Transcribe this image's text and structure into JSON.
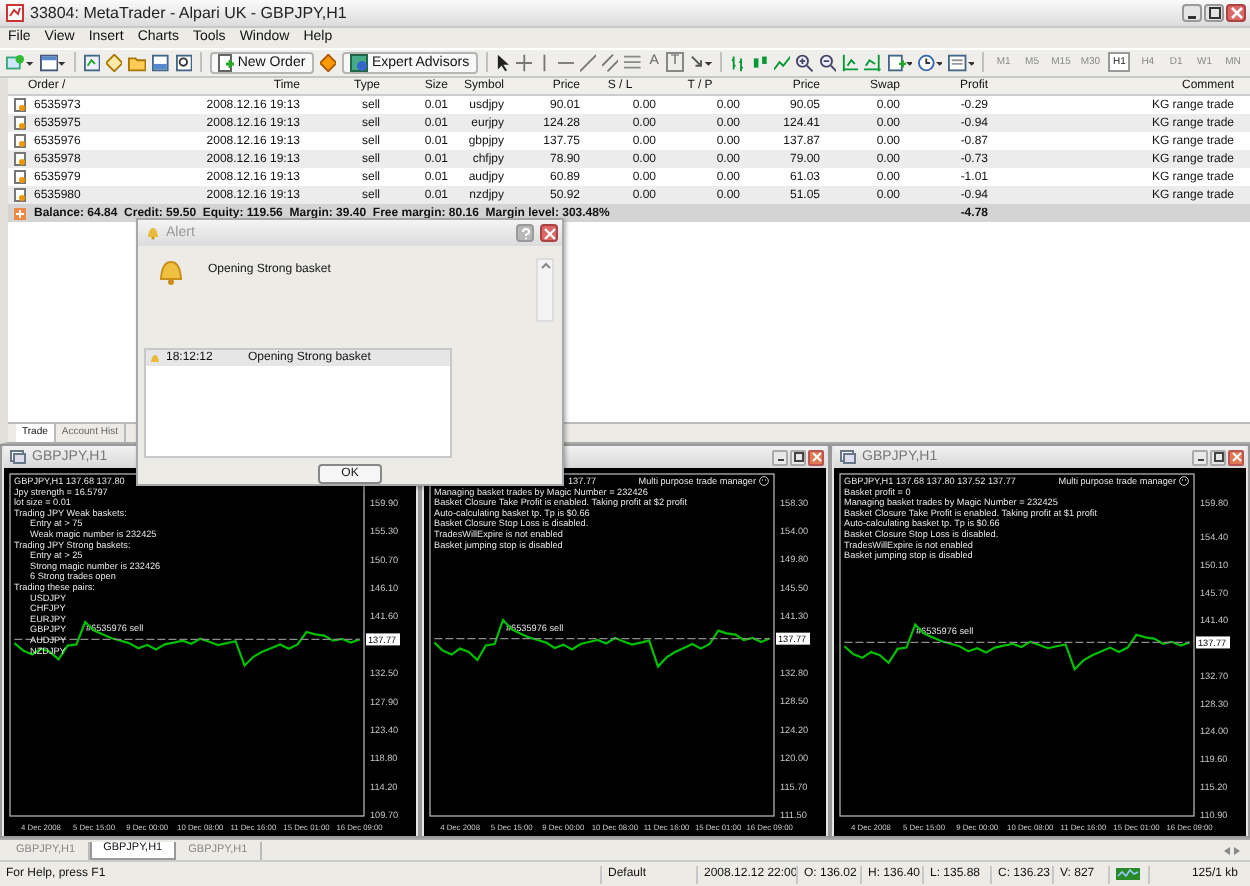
{
  "window": {
    "title": "33804: MetaTrader - Alpari UK - GBPJPY,H1"
  },
  "menu": [
    "File",
    "View",
    "Insert",
    "Charts",
    "Tools",
    "Window",
    "Help"
  ],
  "toolbar": {
    "new_order": "New Order",
    "expert_advisors": "Expert Advisors",
    "text_tools": [
      "A",
      "T"
    ],
    "timeframes": [
      {
        "label": "M1",
        "selected": false
      },
      {
        "label": "M5",
        "selected": false
      },
      {
        "label": "M15",
        "selected": false
      },
      {
        "label": "M30",
        "selected": false
      },
      {
        "label": "H1",
        "selected": true
      },
      {
        "label": "H4",
        "selected": false
      },
      {
        "label": "D1",
        "selected": false
      },
      {
        "label": "W1",
        "selected": false
      },
      {
        "label": "MN",
        "selected": false
      }
    ]
  },
  "terminal": {
    "columns": [
      "Order /",
      "Time",
      "Type",
      "Size",
      "Symbol",
      "Price",
      "S / L",
      "T / P",
      "Price",
      "Swap",
      "Profit",
      "Comment"
    ],
    "rows": [
      [
        "6535973",
        "2008.12.16 19:13",
        "sell",
        "0.01",
        "usdjpy",
        "90.01",
        "0.00",
        "0.00",
        "90.05",
        "0.00",
        "-0.29",
        "KG range trade"
      ],
      [
        "6535975",
        "2008.12.16 19:13",
        "sell",
        "0.01",
        "eurjpy",
        "124.28",
        "0.00",
        "0.00",
        "124.41",
        "0.00",
        "-0.94",
        "KG range trade"
      ],
      [
        "6535976",
        "2008.12.16 19:13",
        "sell",
        "0.01",
        "gbpjpy",
        "137.75",
        "0.00",
        "0.00",
        "137.87",
        "0.00",
        "-0.87",
        "KG range trade"
      ],
      [
        "6535978",
        "2008.12.16 19:13",
        "sell",
        "0.01",
        "chfjpy",
        "78.90",
        "0.00",
        "0.00",
        "79.00",
        "0.00",
        "-0.73",
        "KG range trade"
      ],
      [
        "6535979",
        "2008.12.16 19:13",
        "sell",
        "0.01",
        "audjpy",
        "60.89",
        "0.00",
        "0.00",
        "61.03",
        "0.00",
        "-1.01",
        "KG range trade"
      ],
      [
        "6535980",
        "2008.12.16 19:13",
        "sell",
        "0.01",
        "nzdjpy",
        "50.92",
        "0.00",
        "0.00",
        "51.05",
        "0.00",
        "-0.94",
        "KG range trade"
      ]
    ],
    "summary": {
      "text": "Balance: 64.84  Credit: 59.50  Equity: 119.56  Margin: 39.40  Free margin: 80.16  Margin level: 303.48%",
      "profit": "-4.78"
    },
    "tabs": [
      {
        "label": "Trade",
        "selected": true
      },
      {
        "label": "Account Hist",
        "selected": false
      }
    ]
  },
  "alert": {
    "title": "Alert",
    "message": "Opening Strong basket",
    "log": [
      {
        "time": "18:12:12",
        "message": "Opening Strong basket"
      }
    ],
    "ok": "OK"
  },
  "charts": [
    {
      "title": "GBPJPY,H1",
      "header": "GBPJPY,H1 137.68 137.80",
      "current_price": "137.77",
      "order_label": "#6535976 sell",
      "info": [
        {
          "text": "Jpy strength = 16.5797"
        },
        {
          "text": "lot size = 0.01"
        },
        {
          "text": "Trading JPY Weak baskets:",
          "children": [
            {
              "text": "Entry at > 75"
            },
            {
              "text": "Weak magic number is 232425"
            }
          ]
        },
        {
          "text": "Trading JPY Strong baskets:",
          "children": [
            {
              "text": "Entry at > 25"
            },
            {
              "text": "Strong magic number is 232426"
            },
            {
              "text": "6 Strong trades open"
            }
          ]
        },
        {
          "text": "Trading these pairs:",
          "children": [
            {
              "text": "USDJPY"
            },
            {
              "text": "CHFJPY"
            },
            {
              "text": "EURJPY"
            },
            {
              "text": "GBPJPY"
            },
            {
              "text": "AUDJPY"
            },
            {
              "text": "NZDJPY"
            }
          ]
        }
      ],
      "chart_data": {
        "type": "line",
        "categories": [
          null,
          null,
          null,
          "4 Dec 2008",
          null,
          null,
          null,
          null,
          null,
          "5 Dec 15:00",
          null,
          null,
          null,
          null,
          null,
          "9 Dec 00:00",
          null,
          null,
          null,
          null,
          null,
          "10 Dec 08:00",
          null,
          null,
          null,
          null,
          null,
          "11 Dec 16:00",
          null,
          null,
          null,
          null,
          null,
          "15 Dec 01:00",
          null,
          null,
          null,
          null,
          null,
          "16 Dec 09:00"
        ],
        "ylim": [
          109.4,
          164.4
        ],
        "yticks": [
          {
            "value": 159.9,
            "label": "159.90"
          },
          {
            "value": 155.3,
            "label": "155.30"
          },
          {
            "value": 150.7,
            "label": "150.70"
          },
          {
            "value": 146.1,
            "label": "146.10"
          },
          {
            "value": 141.6,
            "label": "141.60"
          },
          {
            "value": 132.5,
            "label": "132.50"
          },
          {
            "value": 127.9,
            "label": "127.90"
          },
          {
            "value": 123.4,
            "label": "123.40"
          },
          {
            "value": 118.8,
            "label": "118.80"
          },
          {
            "value": 114.2,
            "label": "114.20"
          },
          {
            "value": 109.7,
            "label": "109.70"
          }
        ],
        "series": [
          {
            "color": "#00c000",
            "values": [
              137.2,
              136.0,
              135.4,
              136.3,
              135.8,
              134.6,
              136.8,
              137.0,
              140.6,
              139.2,
              138.6,
              138.0,
              137.6,
              137.2,
              136.4,
              136.9,
              136.2,
              137.0,
              137.3,
              137.6,
              137.1,
              137.9,
              137.4,
              136.9,
              137.2,
              137.5,
              133.6,
              135.0,
              135.8,
              136.4,
              137.0,
              136.3,
              137.0,
              139.0,
              138.6,
              138.4,
              137.6,
              137.9,
              137.3,
              137.8
            ]
          },
          {
            "color": "#8c8c8c",
            "line_style": "dashed",
            "values": [
              137.8,
              137.8,
              137.8,
              137.8,
              137.8,
              137.8,
              137.8,
              137.8,
              137.8,
              137.8,
              137.8,
              137.8,
              137.8,
              137.8,
              137.8,
              137.8,
              137.8,
              137.8,
              137.8,
              137.8,
              137.8,
              137.8,
              137.8,
              137.8,
              137.8,
              137.8,
              137.8,
              137.8,
              137.8,
              137.8,
              137.8,
              137.8,
              137.8,
              137.8,
              137.8,
              137.8,
              137.8,
              137.8,
              137.8,
              137.8
            ]
          }
        ]
      }
    },
    {
      "window_buttons": true,
      "header_tail": "137.77",
      "indicator": "Multi purpose trade manager",
      "current_price": "137.77",
      "order_label": "#6535976 sell",
      "info": [
        {
          "text": "Managing basket trades by Magic Number = 232426"
        },
        {
          "text": "Basket Closure Take Profit is enabled. Taking profit at $2 profit"
        },
        {
          "text": "Auto-calculating basket tp. Tp is $0.66"
        },
        {
          "text": "Basket Closure Stop Loss is disabled."
        },
        {
          "text": "TradesWillExpire is not enabled"
        },
        {
          "text": "Basket jumping stop is disabled"
        }
      ],
      "chart_data": {
        "type": "line",
        "categories": [
          null,
          null,
          null,
          "4 Dec 2008",
          null,
          null,
          null,
          null,
          null,
          "5 Dec 15:00",
          null,
          null,
          null,
          null,
          null,
          "9 Dec 00:00",
          null,
          null,
          null,
          null,
          null,
          "10 Dec 08:00",
          null,
          null,
          null,
          null,
          null,
          "11 Dec 16:00",
          null,
          null,
          null,
          null,
          null,
          "15 Dec 01:00",
          null,
          null,
          null,
          null,
          null,
          "16 Dec 09:00"
        ],
        "ylim": [
          111.2,
          162.5
        ],
        "yticks": [
          {
            "value": 158.3,
            "label": "158.30"
          },
          {
            "value": 154.0,
            "label": "154.00"
          },
          {
            "value": 149.8,
            "label": "149.80"
          },
          {
            "value": 145.5,
            "label": "145.50"
          },
          {
            "value": 141.3,
            "label": "141.30"
          },
          {
            "value": 132.8,
            "label": "132.80"
          },
          {
            "value": 128.5,
            "label": "128.50"
          },
          {
            "value": 124.2,
            "label": "124.20"
          },
          {
            "value": 120.0,
            "label": "120.00"
          },
          {
            "value": 115.7,
            "label": "115.70"
          },
          {
            "value": 111.5,
            "label": "111.50"
          }
        ],
        "series": [
          {
            "color": "#00c000",
            "values": [
              137.2,
              136.0,
              135.4,
              136.3,
              135.8,
              134.6,
              136.8,
              137.0,
              140.6,
              139.2,
              138.6,
              138.0,
              137.6,
              137.2,
              136.4,
              136.9,
              136.2,
              137.0,
              137.3,
              137.6,
              137.1,
              137.9,
              137.4,
              136.9,
              137.2,
              137.5,
              133.6,
              135.0,
              135.8,
              136.4,
              137.0,
              136.3,
              137.0,
              139.0,
              138.6,
              138.4,
              137.6,
              137.9,
              137.3,
              137.8
            ]
          },
          {
            "color": "#8c8c8c",
            "line_style": "dashed",
            "values": [
              137.8,
              137.8,
              137.8,
              137.8,
              137.8,
              137.8,
              137.8,
              137.8,
              137.8,
              137.8,
              137.8,
              137.8,
              137.8,
              137.8,
              137.8,
              137.8,
              137.8,
              137.8,
              137.8,
              137.8,
              137.8,
              137.8,
              137.8,
              137.8,
              137.8,
              137.8,
              137.8,
              137.8,
              137.8,
              137.8,
              137.8,
              137.8,
              137.8,
              137.8,
              137.8,
              137.8,
              137.8,
              137.8,
              137.8,
              137.8
            ]
          }
        ]
      }
    },
    {
      "title": "GBPJPY,H1",
      "window_buttons": true,
      "header": "GBPJPY,H1 137.68 137.80 137.52 137.77",
      "indicator": "Multi purpose trade manager",
      "current_price": "137.77",
      "order_label": "#6535976 sell",
      "info": [
        {
          "text": "Basket profit = 0"
        },
        {
          "text": "Managing basket trades by Magic Number = 232425"
        },
        {
          "text": "Basket Closure Take Profit is enabled. Taking profit at $1 profit"
        },
        {
          "text": "Auto-calculating basket tp. Tp is $0.66"
        },
        {
          "text": "Basket Closure Stop Loss is disabled."
        },
        {
          "text": "TradesWillExpire is not enabled"
        },
        {
          "text": "Basket jumping stop is disabled"
        }
      ],
      "chart_data": {
        "type": "line",
        "categories": [
          null,
          null,
          null,
          "4 Dec 2008",
          null,
          null,
          null,
          null,
          null,
          "5 Dec 15:00",
          null,
          null,
          null,
          null,
          null,
          "9 Dec 00:00",
          null,
          null,
          null,
          null,
          null,
          "10 Dec 08:00",
          null,
          null,
          null,
          null,
          null,
          "11 Dec 16:00",
          null,
          null,
          null,
          null,
          null,
          "15 Dec 01:00",
          null,
          null,
          null,
          null,
          null,
          "16 Dec 09:00"
        ],
        "ylim": [
          110.6,
          164.2
        ],
        "yticks": [
          {
            "value": 159.8,
            "label": "159.80"
          },
          {
            "value": 154.4,
            "label": "154.40"
          },
          {
            "value": 150.1,
            "label": "150.10"
          },
          {
            "value": 145.7,
            "label": "145.70"
          },
          {
            "value": 141.4,
            "label": "141.40"
          },
          {
            "value": 132.7,
            "label": "132.70"
          },
          {
            "value": 128.3,
            "label": "128.30"
          },
          {
            "value": 124.0,
            "label": "124.00"
          },
          {
            "value": 119.6,
            "label": "119.60"
          },
          {
            "value": 115.2,
            "label": "115.20"
          },
          {
            "value": 110.9,
            "label": "110.90"
          }
        ],
        "series": [
          {
            "color": "#00c000",
            "values": [
              137.2,
              136.0,
              135.4,
              136.3,
              135.8,
              134.6,
              136.8,
              137.0,
              140.6,
              139.2,
              138.6,
              138.0,
              137.6,
              137.2,
              136.4,
              136.9,
              136.2,
              137.0,
              137.3,
              137.6,
              137.1,
              137.9,
              137.4,
              136.9,
              137.2,
              137.5,
              133.6,
              135.0,
              135.8,
              136.4,
              137.0,
              136.3,
              137.0,
              139.0,
              138.6,
              138.4,
              137.6,
              137.9,
              137.3,
              137.8
            ]
          },
          {
            "color": "#8c8c8c",
            "line_style": "dashed",
            "values": [
              137.8,
              137.8,
              137.8,
              137.8,
              137.8,
              137.8,
              137.8,
              137.8,
              137.8,
              137.8,
              137.8,
              137.8,
              137.8,
              137.8,
              137.8,
              137.8,
              137.8,
              137.8,
              137.8,
              137.8,
              137.8,
              137.8,
              137.8,
              137.8,
              137.8,
              137.8,
              137.8,
              137.8,
              137.8,
              137.8,
              137.8,
              137.8,
              137.8,
              137.8,
              137.8,
              137.8,
              137.8,
              137.8,
              137.8,
              137.8
            ]
          }
        ]
      }
    }
  ],
  "chart_tabs": [
    {
      "label": "GBPJPY,H1",
      "selected": false
    },
    {
      "label": "GBPJPY,H1",
      "selected": true
    },
    {
      "label": "GBPJPY,H1",
      "selected": false
    }
  ],
  "status_bar": [
    "For Help, press F1",
    "Default",
    "2008.12.12 22:00",
    "O: 136.02",
    "H: 136.40",
    "L: 135.88",
    "C: 136.23",
    "V: 827",
    "125/1 kb"
  ]
}
